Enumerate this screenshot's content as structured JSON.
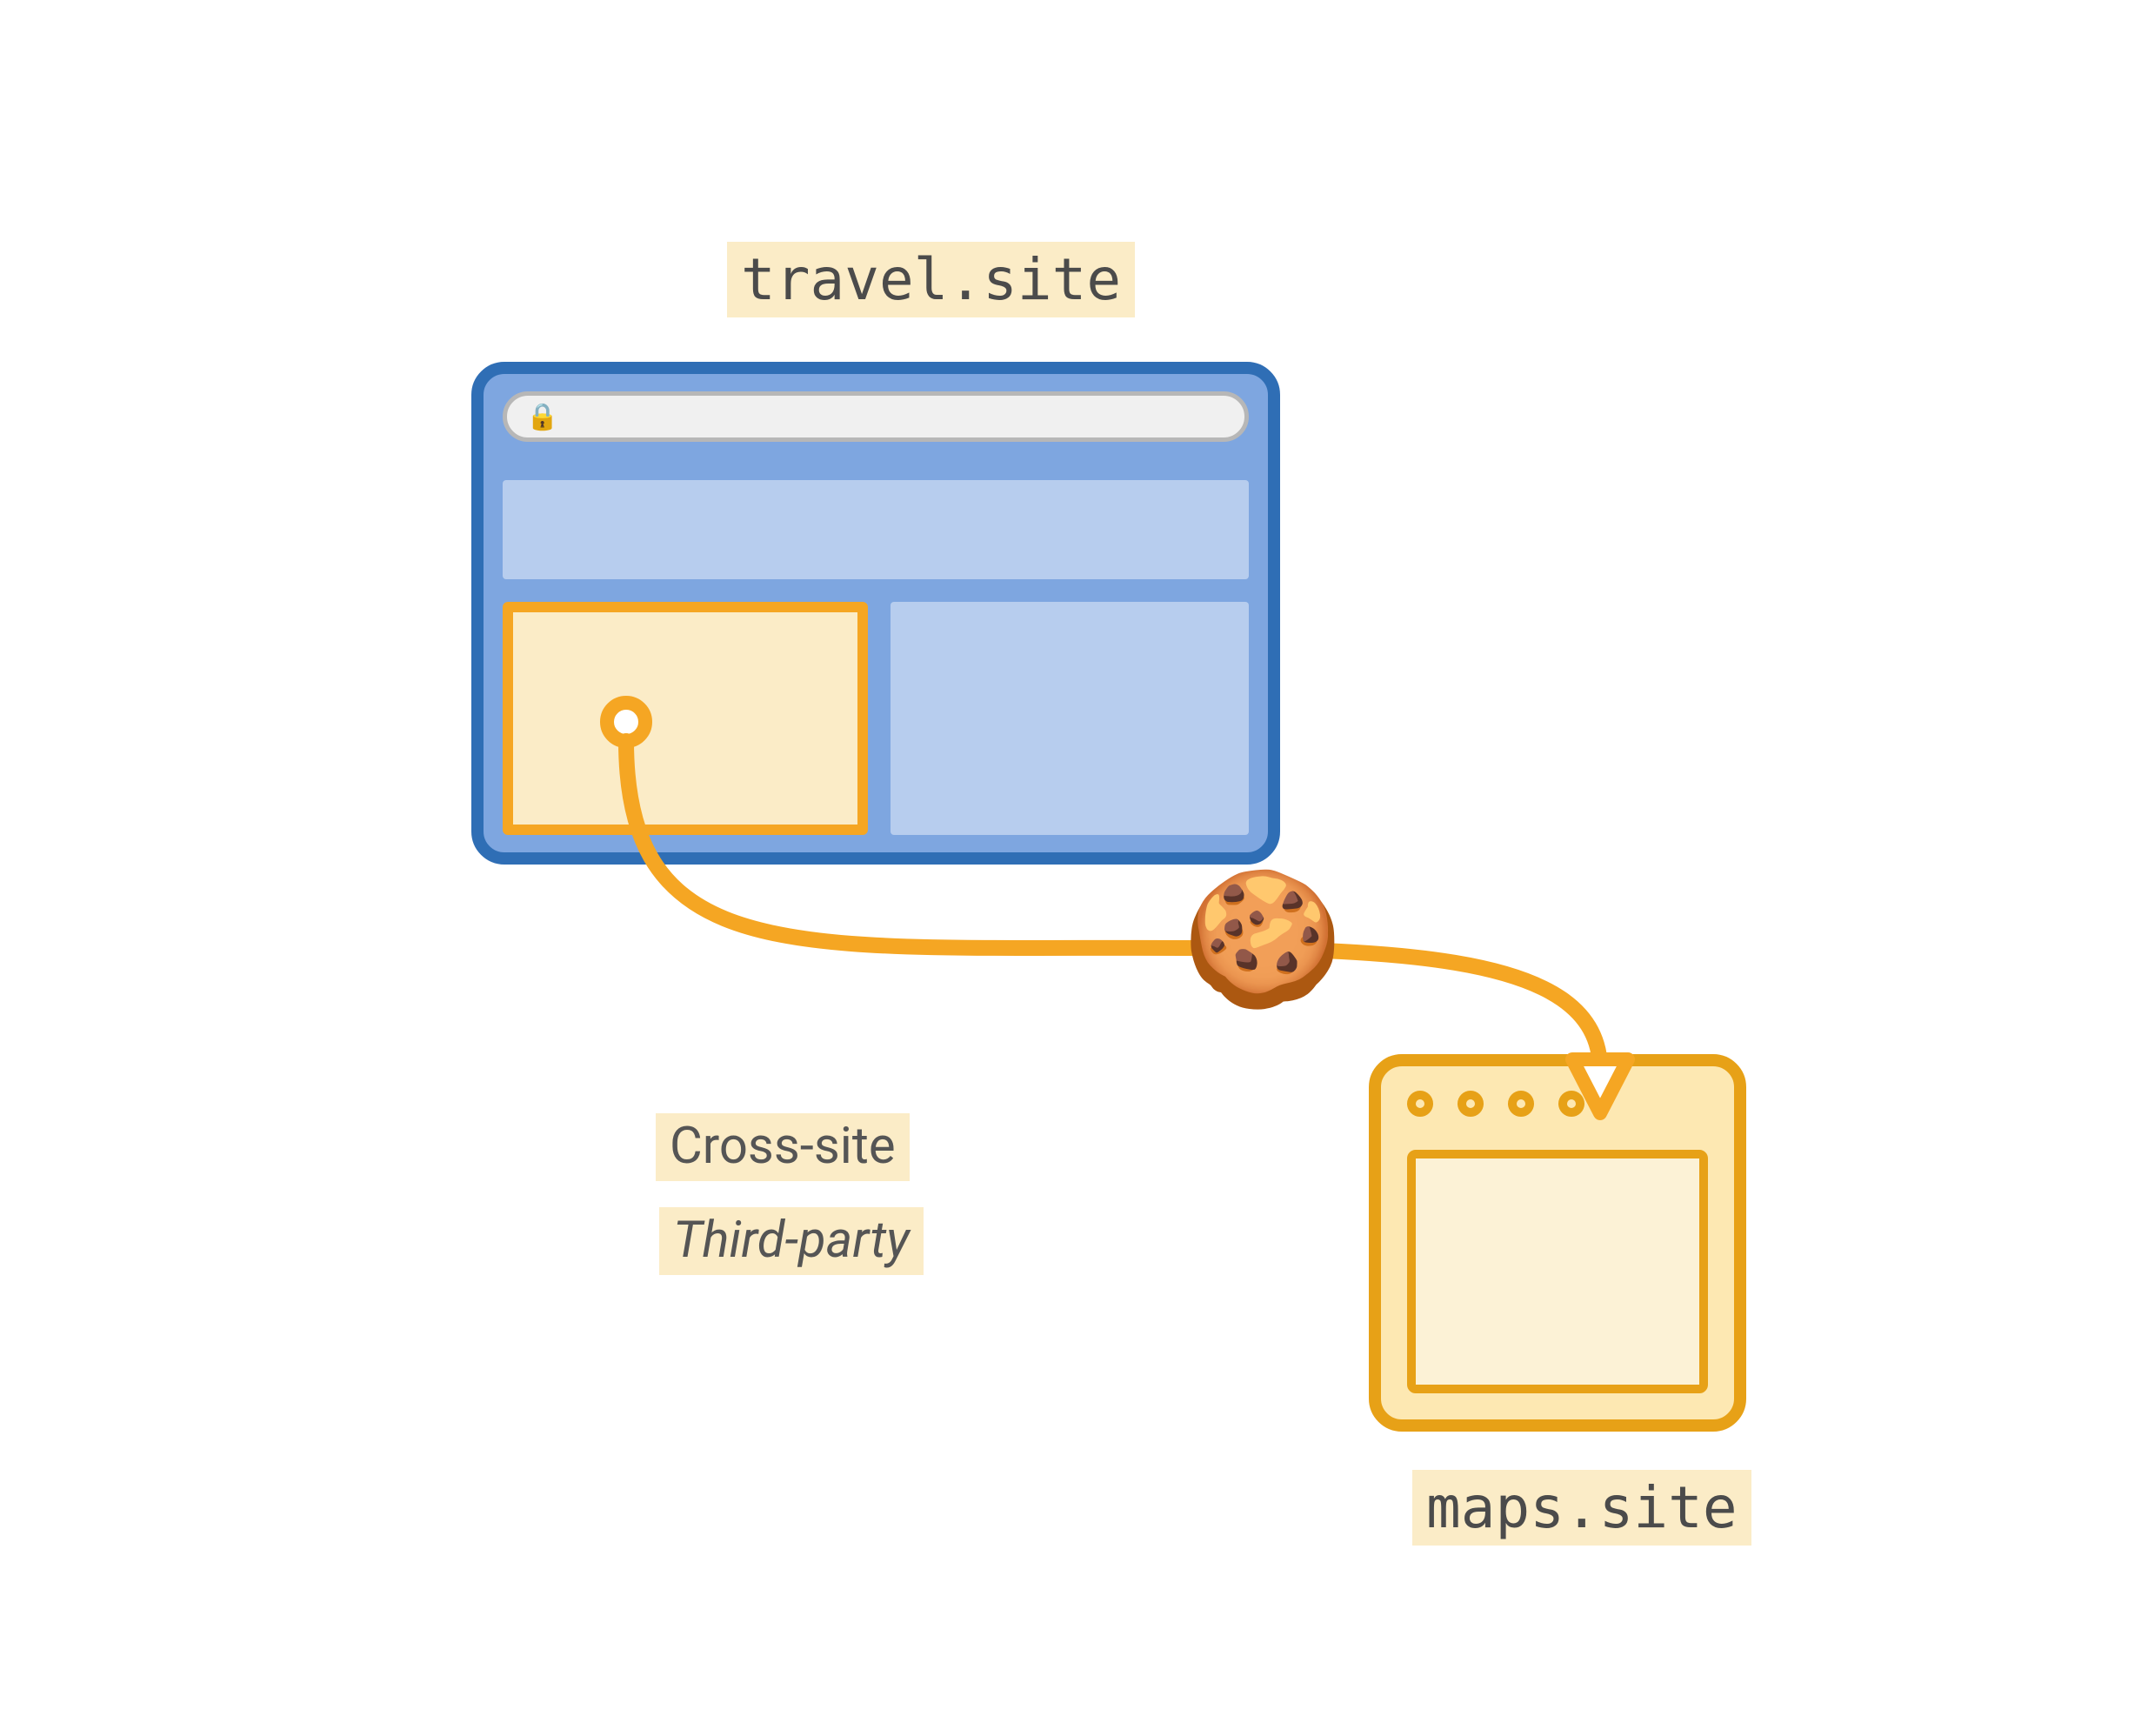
{
  "labels": {
    "top_site": "travel.site",
    "bottom_site": "maps.site",
    "cross_site": "Cross-site",
    "third_party": "Third-party"
  },
  "icons": {
    "cookie": "🍪",
    "lock": "🔒"
  },
  "colors": {
    "highlight_bg": "#fbecc7",
    "browser_border": "#2f6eb5",
    "browser_fill": "#7ea6e0",
    "browser_panel": "#b7cdee",
    "accent": "#f5a623",
    "target_border": "#e7a117",
    "target_fill": "#fde8b2",
    "target_inner": "#fcf2d6"
  }
}
